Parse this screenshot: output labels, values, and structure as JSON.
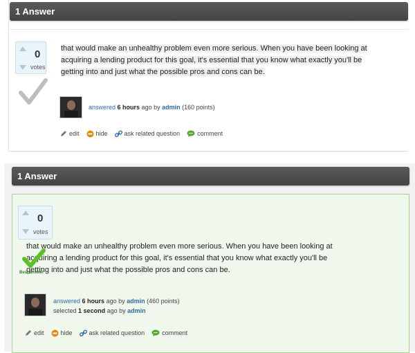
{
  "answers": [
    {
      "header": "1 Answer",
      "votes": "0",
      "votes_label": "votes",
      "text_lines": [
        "that would make an unhealthy problem even more serious. When you have been looking at",
        "acquiring a lending product for this goal, it's essential that you know what exactly you'll be",
        "getting into and just what the possible pros and cons can be."
      ],
      "meta": {
        "answered": "answered",
        "time": "6 hours",
        "ago_by": "ago by",
        "user": "admin",
        "points": "(160 points)"
      },
      "actions": [
        "edit",
        "hide",
        "ask related question",
        "comment"
      ]
    },
    {
      "header": "1 Answer",
      "votes": "0",
      "votes_label": "votes",
      "best_answer_label": "Best answer",
      "text_lines": [
        "that would make an unhealthy problem even more serious. When you have been looking at",
        "acquiring a lending product for this goal, it's essential that you know what exactly you'll be",
        "getting into and just what the possible pros and cons can be."
      ],
      "meta": {
        "answered": "answered",
        "time": "6 hours",
        "ago_by": "ago by",
        "user": "admin",
        "points": "(460 points)",
        "selected": "selected",
        "selected_time": "1 second",
        "selected_ago_by": "ago by",
        "selected_user": "admin"
      },
      "actions": [
        "edit",
        "hide",
        "ask related question",
        "comment"
      ]
    }
  ],
  "colors": {
    "header_bg": "#4a4a4a",
    "link": "#2f6aa3",
    "best_answer_bg": "#f0f8ee",
    "best_answer_border": "#9fd48e",
    "check_green": "#5cbf2a",
    "check_gray": "#bdbdbd"
  },
  "icons": {
    "edit": "pencil-icon",
    "hide": "minus-circle-icon",
    "ask": "link-icon",
    "comment": "comment-bubble-icon"
  }
}
